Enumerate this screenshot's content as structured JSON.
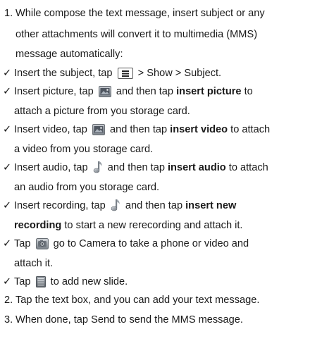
{
  "steps": {
    "step1": {
      "num": "1.",
      "line1": "While compose the text message, insert subject or any",
      "line2": "other attachments will convert it to multimedia (MMS)",
      "line3": "message automatically:"
    },
    "bullets": {
      "check": "✓",
      "subject": {
        "pre": "Insert the subject, tap",
        "post": " > Show > Subject.",
        "icon": "menu-icon"
      },
      "picture": {
        "pre": "Insert picture, tap",
        "mid": " and then tap ",
        "bold": "insert picture",
        "post": " to",
        "line2": "attach a picture from you storage card.",
        "icon": "picture-icon"
      },
      "video": {
        "pre": "Insert video, tap",
        "mid": " and then tap ",
        "bold": "insert video",
        "post": " to attach",
        "line2": "a video from you storage card.",
        "icon": "picture-icon"
      },
      "audio": {
        "pre": "Insert audio, tap",
        "mid": " and then tap ",
        "bold": "insert audio",
        "post": " to attach",
        "line2": "an audio from you storage card.",
        "icon": "music-note-icon"
      },
      "recording": {
        "pre": "Insert recording, tap",
        "mid": " and then tap ",
        "bold": "insert new",
        "line2bold": "recording",
        "line2": " to start a new rerecording and attach it.",
        "icon": "music-note-icon"
      },
      "camera": {
        "pre": "Tap",
        "post": " go to Camera to take a phone or video and",
        "line2": "attach it.",
        "icon": "camera-icon"
      },
      "slide": {
        "pre": "Tap",
        "post": " to add new slide.",
        "icon": "slide-icon"
      }
    },
    "step2": {
      "num": "2.",
      "text": "Tap the text box, and you can add your text message."
    },
    "step3": {
      "num": "3.",
      "text": "When done, tap Send to send the MMS message."
    }
  }
}
